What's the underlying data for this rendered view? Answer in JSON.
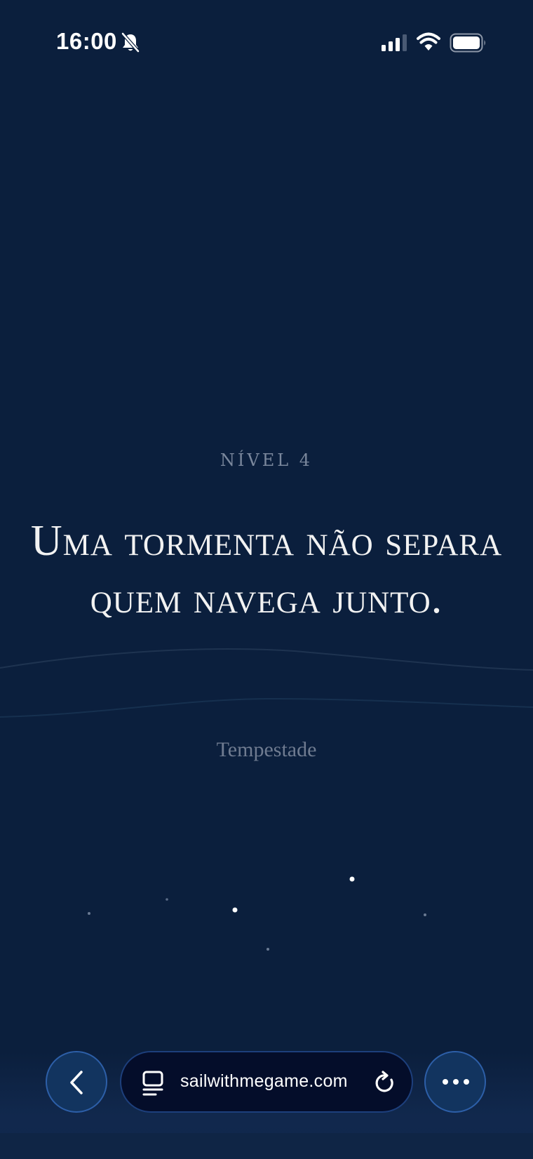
{
  "status_bar": {
    "time": "16:00",
    "icons": [
      "bell-slash-icon",
      "cellular-signal-icon",
      "wifi-icon",
      "battery-icon"
    ]
  },
  "content": {
    "level_label": "NÍVEL 4",
    "headline": "Uma tormenta não separa quem navega junto.",
    "subtitle": "Tempestade"
  },
  "browser_bar": {
    "url": "sailwithmegame.com",
    "back_icon": "chevron-left-icon",
    "page_icon": "page-settings-icon",
    "reload_icon": "reload-icon",
    "more_icon": "more-dots-icon"
  },
  "colors": {
    "background": "#0b1f3d",
    "accent_border": "#2d5fa8",
    "url_bar_bg": "#040d2a",
    "muted_text": "#7a879c"
  }
}
